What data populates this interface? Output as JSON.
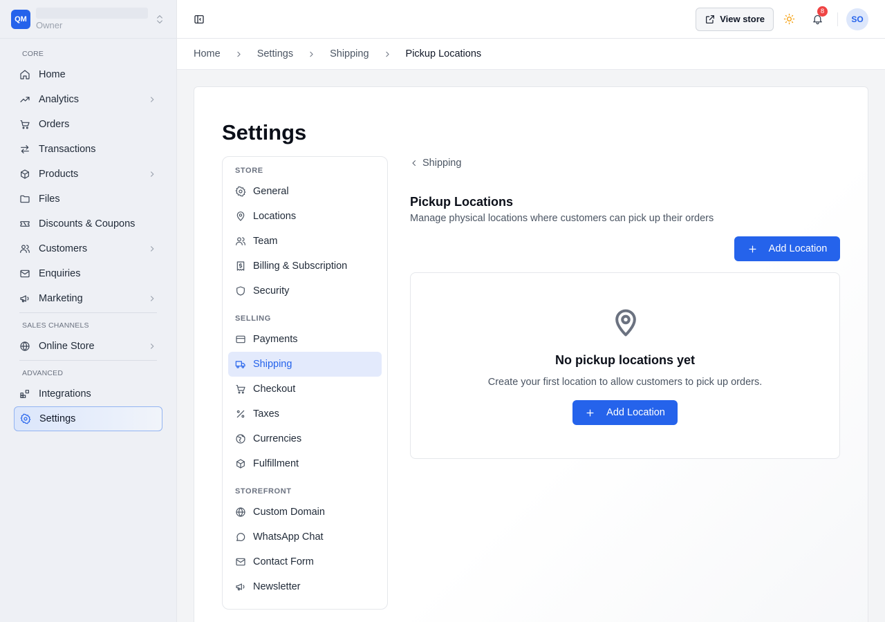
{
  "brand": {
    "initials": "QM",
    "role": "Owner"
  },
  "sidebar": {
    "sections": [
      {
        "label": "CORE"
      },
      {
        "label": "SALES CHANNELS"
      },
      {
        "label": "ADVANCED"
      }
    ],
    "items": {
      "home": "Home",
      "analytics": "Analytics",
      "orders": "Orders",
      "transactions": "Transactions",
      "products": "Products",
      "files": "Files",
      "discounts": "Discounts & Coupons",
      "customers": "Customers",
      "enquiries": "Enquiries",
      "marketing": "Marketing",
      "online_store": "Online Store",
      "integrations": "Integrations",
      "settings": "Settings"
    },
    "active": "settings"
  },
  "topbar": {
    "view_store_label": "View store",
    "notifications_count": "8",
    "avatar_initials": "SO"
  },
  "breadcrumb": [
    "Home",
    "Settings",
    "Shipping",
    "Pickup Locations"
  ],
  "page": {
    "title": "Settings",
    "back_label": "Shipping",
    "section_title": "Pickup Locations",
    "section_subtitle": "Manage physical locations where customers can pick up their orders",
    "add_button_label": "Add Location",
    "empty_title": "No pickup locations yet",
    "empty_subtitle": "Create your first location to allow customers to pick up orders.",
    "empty_button_label": "Add Location"
  },
  "settings_nav": {
    "store_label": "STORE",
    "selling_label": "SELLING",
    "storefront_label": "STOREFRONT",
    "general": "General",
    "locations": "Locations",
    "team": "Team",
    "billing": "Billing & Subscription",
    "security": "Security",
    "payments": "Payments",
    "shipping": "Shipping",
    "checkout": "Checkout",
    "taxes": "Taxes",
    "currencies": "Currencies",
    "fulfillment": "Fulfillment",
    "custom_domain": "Custom Domain",
    "whatsapp": "WhatsApp Chat",
    "contact_form": "Contact Form",
    "newsletter": "Newsletter",
    "active": "shipping"
  },
  "colors": {
    "accent": "#2563eb",
    "badge": "#ef4444",
    "sun": "#f59e0b"
  }
}
